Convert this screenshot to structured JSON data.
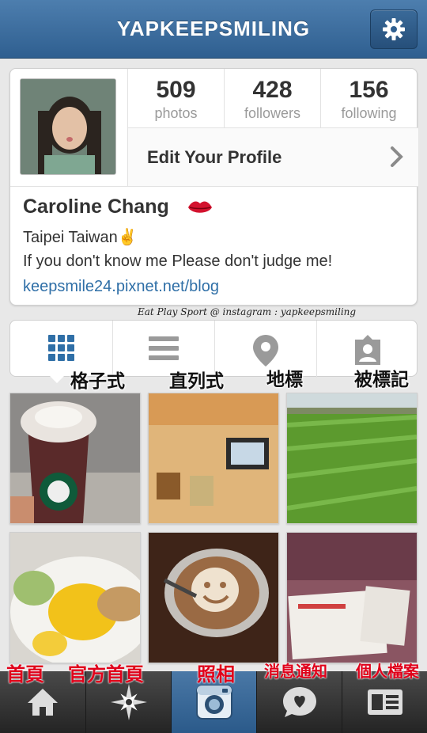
{
  "header": {
    "title": "YAPKEEPSMILING",
    "settings_icon": "gear-icon"
  },
  "profile": {
    "stats": [
      {
        "value": "509",
        "label": "photos"
      },
      {
        "value": "428",
        "label": "followers"
      },
      {
        "value": "156",
        "label": "following"
      }
    ],
    "edit_label": "Edit Your Profile",
    "name": "Caroline Chang",
    "bio_line1": "Taipei Taiwan✌",
    "bio_line2": "If you don't know me Please don't judge me!",
    "website": "keepsmile24.pixnet.net/blog"
  },
  "watermark": "Eat Play Sport @ instagram : yapkeepsmiling",
  "view_tabs": [
    {
      "icon": "grid-icon",
      "annotation": "格子式"
    },
    {
      "icon": "list-icon",
      "annotation": "直列式"
    },
    {
      "icon": "map-pin-icon",
      "annotation": "地標"
    },
    {
      "icon": "tagged-person-icon",
      "annotation": "被標記"
    }
  ],
  "photos": [
    {
      "subject": "starbucks-drink"
    },
    {
      "subject": "room-tv"
    },
    {
      "subject": "rice-field"
    },
    {
      "subject": "breakfast-plate"
    },
    {
      "subject": "latte-art"
    },
    {
      "subject": "tickets"
    }
  ],
  "bottom_nav": [
    {
      "icon": "home-icon",
      "annotation": "首頁"
    },
    {
      "icon": "explore-star-icon",
      "annotation": "官方首頁"
    },
    {
      "icon": "camera-icon",
      "annotation": "照相"
    },
    {
      "icon": "news-bubble-icon",
      "annotation": "消息通知"
    },
    {
      "icon": "profile-card-icon",
      "annotation": "個人檔案"
    }
  ],
  "colors": {
    "header_blue": "#3b6b9b",
    "link_blue": "#2f6fa7",
    "annotation_red": "#e0001a"
  }
}
